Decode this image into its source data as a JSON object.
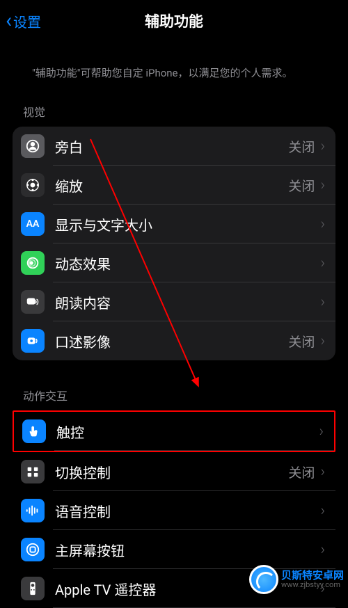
{
  "header": {
    "back_label": "设置",
    "title": "辅助功能"
  },
  "description": "\"辅助功能\"可帮助您自定 iPhone，以满足您的个人需求。",
  "sections": {
    "vision": {
      "header": "视觉",
      "items": [
        {
          "label": "旁白",
          "value": "关闭"
        },
        {
          "label": "缩放",
          "value": "关闭"
        },
        {
          "label": "显示与文字大小",
          "value": ""
        },
        {
          "label": "动态效果",
          "value": ""
        },
        {
          "label": "朗读内容",
          "value": ""
        },
        {
          "label": "口述影像",
          "value": "关闭"
        }
      ]
    },
    "interaction": {
      "header": "动作交互",
      "items": [
        {
          "label": "触控",
          "value": ""
        },
        {
          "label": "切换控制",
          "value": "关闭"
        },
        {
          "label": "语音控制",
          "value": ""
        },
        {
          "label": "主屏幕按钮",
          "value": ""
        },
        {
          "label": "Apple TV 遥控器",
          "value": ""
        }
      ]
    }
  },
  "watermark": {
    "title": "贝斯特安卓网",
    "url": "www.zjbstyy.com"
  }
}
